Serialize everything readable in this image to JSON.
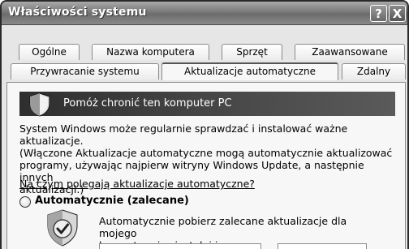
{
  "window": {
    "title": "Właściwości systemu",
    "help_label": "?",
    "close_label": "X"
  },
  "tabs_row1": [
    {
      "label": "Ogólne"
    },
    {
      "label": "Nazwa komputera"
    },
    {
      "label": "Sprzęt"
    },
    {
      "label": "Zaawansowane"
    }
  ],
  "tabs_row2": [
    {
      "label": "Przywracanie systemu"
    },
    {
      "label": "Aktualizacje automatyczne",
      "active": true
    },
    {
      "label": "Zdalny"
    }
  ],
  "banner": {
    "text": "Pomóż chronić ten komputer PC",
    "icon": "shield-icon"
  },
  "description": {
    "line1": "System Windows może regularnie sprawdzać i instalować ważne aktualizacje.",
    "line2": "(Włączone Aktualizacje automatyczne mogą automatycznie aktualizować",
    "line3": "programy, używając najpierw witryny Windows Update, a następnie innych",
    "line4": "aktualizacji.)"
  },
  "help_link": "Na czym polegają aktualizacje automatyczne?",
  "option_auto": {
    "label": "Automatycznie (zalecane)",
    "selected": false,
    "desc_line1": "Automatycznie pobierz zalecane aktualizacje dla mojego",
    "desc_line2": "komputera i zainstaluj je:"
  }
}
